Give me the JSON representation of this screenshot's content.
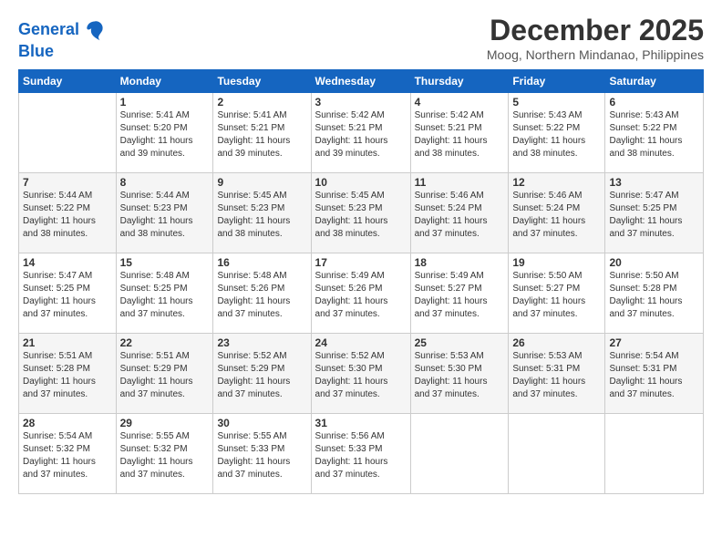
{
  "logo": {
    "line1": "General",
    "line2": "Blue"
  },
  "title": "December 2025",
  "location": "Moog, Northern Mindanao, Philippines",
  "weekdays": [
    "Sunday",
    "Monday",
    "Tuesday",
    "Wednesday",
    "Thursday",
    "Friday",
    "Saturday"
  ],
  "weeks": [
    [
      {
        "day": "",
        "info": ""
      },
      {
        "day": "1",
        "info": "Sunrise: 5:41 AM\nSunset: 5:20 PM\nDaylight: 11 hours\nand 39 minutes."
      },
      {
        "day": "2",
        "info": "Sunrise: 5:41 AM\nSunset: 5:21 PM\nDaylight: 11 hours\nand 39 minutes."
      },
      {
        "day": "3",
        "info": "Sunrise: 5:42 AM\nSunset: 5:21 PM\nDaylight: 11 hours\nand 39 minutes."
      },
      {
        "day": "4",
        "info": "Sunrise: 5:42 AM\nSunset: 5:21 PM\nDaylight: 11 hours\nand 38 minutes."
      },
      {
        "day": "5",
        "info": "Sunrise: 5:43 AM\nSunset: 5:22 PM\nDaylight: 11 hours\nand 38 minutes."
      },
      {
        "day": "6",
        "info": "Sunrise: 5:43 AM\nSunset: 5:22 PM\nDaylight: 11 hours\nand 38 minutes."
      }
    ],
    [
      {
        "day": "7",
        "info": "Sunrise: 5:44 AM\nSunset: 5:22 PM\nDaylight: 11 hours\nand 38 minutes."
      },
      {
        "day": "8",
        "info": "Sunrise: 5:44 AM\nSunset: 5:23 PM\nDaylight: 11 hours\nand 38 minutes."
      },
      {
        "day": "9",
        "info": "Sunrise: 5:45 AM\nSunset: 5:23 PM\nDaylight: 11 hours\nand 38 minutes."
      },
      {
        "day": "10",
        "info": "Sunrise: 5:45 AM\nSunset: 5:23 PM\nDaylight: 11 hours\nand 38 minutes."
      },
      {
        "day": "11",
        "info": "Sunrise: 5:46 AM\nSunset: 5:24 PM\nDaylight: 11 hours\nand 37 minutes."
      },
      {
        "day": "12",
        "info": "Sunrise: 5:46 AM\nSunset: 5:24 PM\nDaylight: 11 hours\nand 37 minutes."
      },
      {
        "day": "13",
        "info": "Sunrise: 5:47 AM\nSunset: 5:25 PM\nDaylight: 11 hours\nand 37 minutes."
      }
    ],
    [
      {
        "day": "14",
        "info": "Sunrise: 5:47 AM\nSunset: 5:25 PM\nDaylight: 11 hours\nand 37 minutes."
      },
      {
        "day": "15",
        "info": "Sunrise: 5:48 AM\nSunset: 5:25 PM\nDaylight: 11 hours\nand 37 minutes."
      },
      {
        "day": "16",
        "info": "Sunrise: 5:48 AM\nSunset: 5:26 PM\nDaylight: 11 hours\nand 37 minutes."
      },
      {
        "day": "17",
        "info": "Sunrise: 5:49 AM\nSunset: 5:26 PM\nDaylight: 11 hours\nand 37 minutes."
      },
      {
        "day": "18",
        "info": "Sunrise: 5:49 AM\nSunset: 5:27 PM\nDaylight: 11 hours\nand 37 minutes."
      },
      {
        "day": "19",
        "info": "Sunrise: 5:50 AM\nSunset: 5:27 PM\nDaylight: 11 hours\nand 37 minutes."
      },
      {
        "day": "20",
        "info": "Sunrise: 5:50 AM\nSunset: 5:28 PM\nDaylight: 11 hours\nand 37 minutes."
      }
    ],
    [
      {
        "day": "21",
        "info": "Sunrise: 5:51 AM\nSunset: 5:28 PM\nDaylight: 11 hours\nand 37 minutes."
      },
      {
        "day": "22",
        "info": "Sunrise: 5:51 AM\nSunset: 5:29 PM\nDaylight: 11 hours\nand 37 minutes."
      },
      {
        "day": "23",
        "info": "Sunrise: 5:52 AM\nSunset: 5:29 PM\nDaylight: 11 hours\nand 37 minutes."
      },
      {
        "day": "24",
        "info": "Sunrise: 5:52 AM\nSunset: 5:30 PM\nDaylight: 11 hours\nand 37 minutes."
      },
      {
        "day": "25",
        "info": "Sunrise: 5:53 AM\nSunset: 5:30 PM\nDaylight: 11 hours\nand 37 minutes."
      },
      {
        "day": "26",
        "info": "Sunrise: 5:53 AM\nSunset: 5:31 PM\nDaylight: 11 hours\nand 37 minutes."
      },
      {
        "day": "27",
        "info": "Sunrise: 5:54 AM\nSunset: 5:31 PM\nDaylight: 11 hours\nand 37 minutes."
      }
    ],
    [
      {
        "day": "28",
        "info": "Sunrise: 5:54 AM\nSunset: 5:32 PM\nDaylight: 11 hours\nand 37 minutes."
      },
      {
        "day": "29",
        "info": "Sunrise: 5:55 AM\nSunset: 5:32 PM\nDaylight: 11 hours\nand 37 minutes."
      },
      {
        "day": "30",
        "info": "Sunrise: 5:55 AM\nSunset: 5:33 PM\nDaylight: 11 hours\nand 37 minutes."
      },
      {
        "day": "31",
        "info": "Sunrise: 5:56 AM\nSunset: 5:33 PM\nDaylight: 11 hours\nand 37 minutes."
      },
      {
        "day": "",
        "info": ""
      },
      {
        "day": "",
        "info": ""
      },
      {
        "day": "",
        "info": ""
      }
    ]
  ]
}
